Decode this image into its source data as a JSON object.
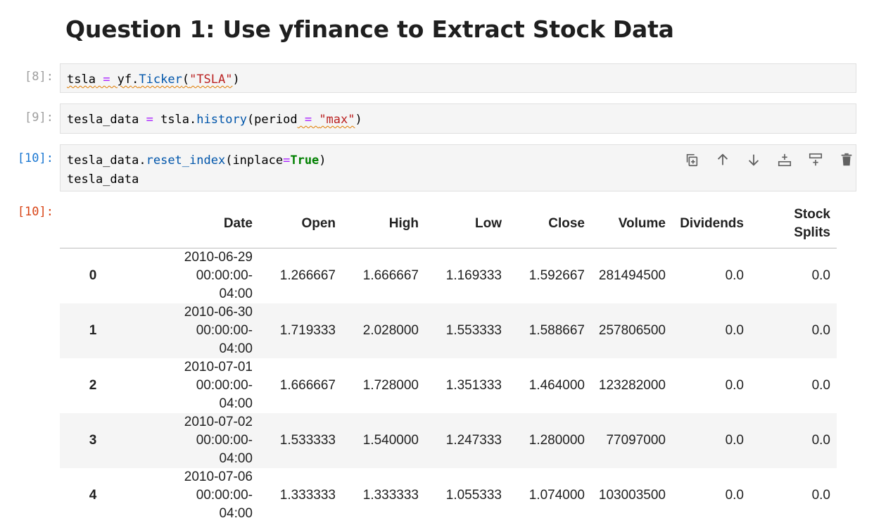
{
  "heading": "Question 1: Use yfinance to Extract Stock Data",
  "cells": [
    {
      "prompt": "[8]:",
      "code_parts": [
        "tsla",
        " = ",
        "yf",
        ".",
        "Ticker",
        "(",
        "\"TSLA\"",
        ")"
      ]
    },
    {
      "prompt": "[9]:",
      "code_parts": [
        "tesla_data",
        " = ",
        "tsla",
        ".",
        "history",
        "(period",
        " = ",
        "\"max\"",
        ")"
      ]
    },
    {
      "prompt": "[10]:",
      "line1_parts": [
        "tesla_data",
        ".",
        "reset_index",
        "(inplace",
        "=",
        "True",
        ")"
      ],
      "line2": "tesla_data"
    }
  ],
  "output_prompt": "[10]:",
  "toolbar": [
    "duplicate-cell",
    "move-up",
    "move-down",
    "insert-above",
    "insert-below",
    "delete-cell"
  ],
  "table": {
    "headers": [
      "Date",
      "Open",
      "High",
      "Low",
      "Close",
      "Volume",
      "Dividends",
      "Stock Splits"
    ],
    "header_stock_1": "Stock",
    "header_stock_2": "Splits",
    "rows": [
      {
        "index": "0",
        "date1": "2010-06-29 00:00:00-",
        "date2": "04:00",
        "open": "1.266667",
        "high": "1.666667",
        "low": "1.169333",
        "close": "1.592667",
        "volume": "281494500",
        "dividends": "0.0",
        "splits": "0.0"
      },
      {
        "index": "1",
        "date1": "2010-06-30 00:00:00-",
        "date2": "04:00",
        "open": "1.719333",
        "high": "2.028000",
        "low": "1.553333",
        "close": "1.588667",
        "volume": "257806500",
        "dividends": "0.0",
        "splits": "0.0"
      },
      {
        "index": "2",
        "date1": "2010-07-01 00:00:00-",
        "date2": "04:00",
        "open": "1.666667",
        "high": "1.728000",
        "low": "1.351333",
        "close": "1.464000",
        "volume": "123282000",
        "dividends": "0.0",
        "splits": "0.0"
      },
      {
        "index": "3",
        "date1": "2010-07-02 00:00:00-",
        "date2": "04:00",
        "open": "1.533333",
        "high": "1.540000",
        "low": "1.247333",
        "close": "1.280000",
        "volume": "77097000",
        "dividends": "0.0",
        "splits": "0.0"
      },
      {
        "index": "4",
        "date1": "2010-07-06 00:00:00-",
        "date2": "04:00",
        "open": "1.333333",
        "high": "1.333333",
        "low": "1.055333",
        "close": "1.074000",
        "volume": "103003500",
        "dividends": "0.0",
        "splits": "0.0"
      }
    ]
  }
}
